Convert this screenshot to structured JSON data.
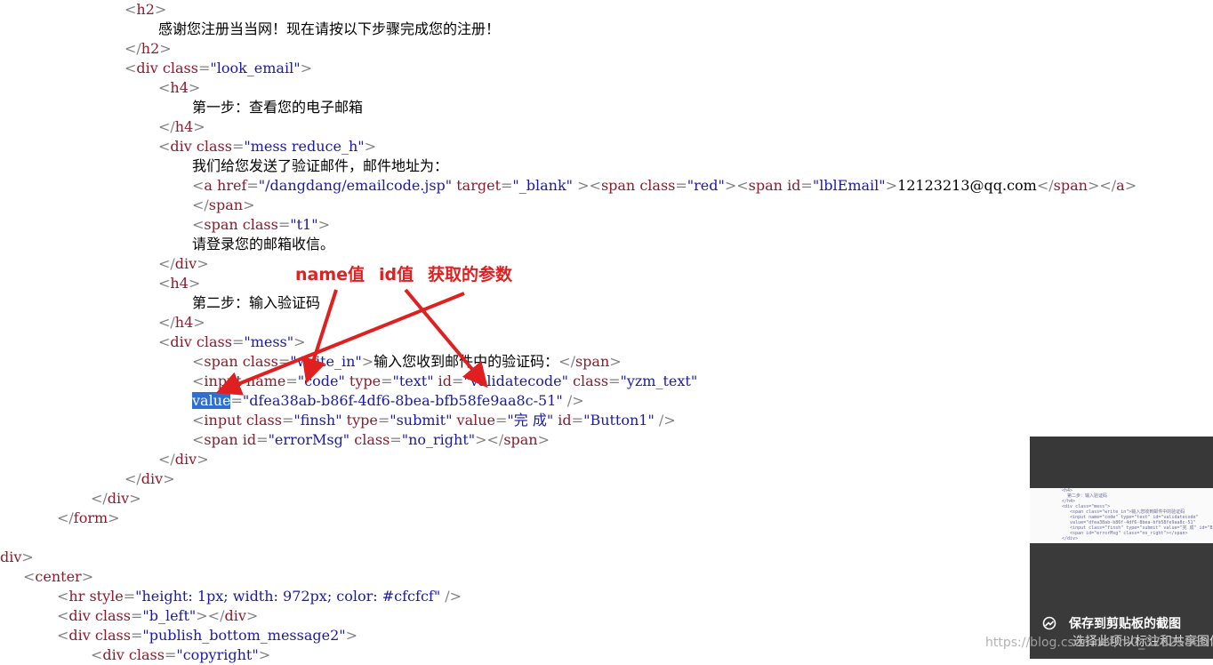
{
  "code_lines": [
    {
      "seg": [
        [
          "t",
          "<"
        ],
        [
          "tag",
          "h2"
        ],
        [
          "t",
          ">"
        ]
      ]
    },
    {
      "seg": [
        [
          "txt",
          "感谢您注册当当网！现在请按以下步骤完成您的注册！"
        ]
      ]
    },
    {
      "seg": [
        [
          "t",
          "</"
        ],
        [
          "tag",
          "h2"
        ],
        [
          "t",
          ">"
        ]
      ]
    },
    {
      "seg": [
        [
          "t",
          "<"
        ],
        [
          "tag",
          "div "
        ],
        [
          "attr",
          "class"
        ],
        [
          "t",
          "="
        ],
        [
          "val",
          "\"look_email\""
        ],
        [
          "t",
          ">"
        ]
      ]
    },
    {
      "seg": [
        [
          "t",
          "<"
        ],
        [
          "tag",
          "h4"
        ],
        [
          "t",
          ">"
        ]
      ]
    },
    {
      "seg": [
        [
          "txt",
          "第一步：查看您的电子邮箱"
        ]
      ]
    },
    {
      "seg": [
        [
          "t",
          "</"
        ],
        [
          "tag",
          "h4"
        ],
        [
          "t",
          ">"
        ]
      ]
    },
    {
      "seg": [
        [
          "t",
          "<"
        ],
        [
          "tag",
          "div "
        ],
        [
          "attr",
          "class"
        ],
        [
          "t",
          "="
        ],
        [
          "val",
          "\"mess reduce_h\""
        ],
        [
          "t",
          ">"
        ]
      ]
    },
    {
      "seg": [
        [
          "txt",
          "我们给您发送了验证邮件，邮件地址为："
        ]
      ]
    },
    {
      "seg": [
        [
          "t",
          "<"
        ],
        [
          "tag",
          "a "
        ],
        [
          "attr",
          "href"
        ],
        [
          "t",
          "="
        ],
        [
          "val",
          "\"/dangdang/emailcode.jsp\""
        ],
        [
          "attr",
          " target"
        ],
        [
          "t",
          "="
        ],
        [
          "val",
          "\"_blank\""
        ],
        [
          "t",
          " ><"
        ],
        [
          "tag",
          "span "
        ],
        [
          "attr",
          "class"
        ],
        [
          "t",
          "="
        ],
        [
          "val",
          "\"red\""
        ],
        [
          "t",
          "><"
        ],
        [
          "tag",
          "span "
        ],
        [
          "attr",
          "id"
        ],
        [
          "t",
          "="
        ],
        [
          "val",
          "\"lblEmail\""
        ],
        [
          "t",
          ">"
        ],
        [
          "txt",
          "12123213@qq.com"
        ],
        [
          "t",
          "</"
        ],
        [
          "tag",
          "span"
        ],
        [
          "t",
          "></"
        ],
        [
          "tag",
          "a"
        ],
        [
          "t",
          ">"
        ]
      ]
    },
    {
      "seg": [
        [
          "t",
          "</"
        ],
        [
          "tag",
          "span"
        ],
        [
          "t",
          ">"
        ]
      ]
    },
    {
      "seg": [
        [
          "t",
          "<"
        ],
        [
          "tag",
          "span "
        ],
        [
          "attr",
          "class"
        ],
        [
          "t",
          "="
        ],
        [
          "val",
          "\"t1\""
        ],
        [
          "t",
          ">"
        ]
      ]
    },
    {
      "seg": [
        [
          "txt",
          "请登录您的邮箱收信。"
        ]
      ]
    },
    {
      "seg": [
        [
          "t",
          "</"
        ],
        [
          "tag",
          "div"
        ],
        [
          "t",
          ">"
        ]
      ]
    },
    {
      "seg": [
        [
          "t",
          "<"
        ],
        [
          "tag",
          "h4"
        ],
        [
          "t",
          ">"
        ]
      ]
    },
    {
      "seg": [
        [
          "txt",
          "第二步：输入验证码"
        ]
      ]
    },
    {
      "seg": [
        [
          "t",
          "</"
        ],
        [
          "tag",
          "h4"
        ],
        [
          "t",
          ">"
        ]
      ]
    },
    {
      "seg": [
        [
          "t",
          "<"
        ],
        [
          "tag",
          "div "
        ],
        [
          "attr",
          "class"
        ],
        [
          "t",
          "="
        ],
        [
          "val",
          "\"mess\""
        ],
        [
          "t",
          ">"
        ]
      ]
    },
    {
      "seg": [
        [
          "t",
          "<"
        ],
        [
          "tag",
          "span "
        ],
        [
          "attr",
          "class"
        ],
        [
          "t",
          "="
        ],
        [
          "val",
          "\"write_in\""
        ],
        [
          "t",
          ">"
        ],
        [
          "txt",
          "输入您收到邮件中的验证码："
        ],
        [
          "t",
          "</"
        ],
        [
          "tag",
          "span"
        ],
        [
          "t",
          ">"
        ]
      ]
    },
    {
      "seg": [
        [
          "t",
          "<"
        ],
        [
          "tag",
          "input "
        ],
        [
          "attr",
          "name"
        ],
        [
          "t",
          "="
        ],
        [
          "val",
          "\"code\""
        ],
        [
          "attr",
          " type"
        ],
        [
          "t",
          "="
        ],
        [
          "val",
          "\"text\""
        ],
        [
          "attr",
          " id"
        ],
        [
          "t",
          "="
        ],
        [
          "val",
          "\"validatecode\""
        ],
        [
          "attr",
          " class"
        ],
        [
          "t",
          "="
        ],
        [
          "val",
          "\"yzm_text\""
        ]
      ]
    },
    {
      "seg": [
        [
          "sel",
          "value"
        ],
        [
          "t",
          "="
        ],
        [
          "val",
          "\"dfea38ab-b86f-4df6-8bea-bfb58fe9aa8c-51\""
        ],
        [
          "t",
          " />"
        ]
      ]
    },
    {
      "seg": [
        [
          "t",
          "<"
        ],
        [
          "tag",
          "input "
        ],
        [
          "attr",
          "class"
        ],
        [
          "t",
          "="
        ],
        [
          "val",
          "\"finsh\""
        ],
        [
          "attr",
          " type"
        ],
        [
          "t",
          "="
        ],
        [
          "val",
          "\"submit\""
        ],
        [
          "attr",
          " value"
        ],
        [
          "t",
          "="
        ],
        [
          "val",
          "\"完 成\""
        ],
        [
          "attr",
          " id"
        ],
        [
          "t",
          "="
        ],
        [
          "val",
          "\"Button1\""
        ],
        [
          "t",
          " />"
        ]
      ]
    },
    {
      "seg": [
        [
          "t",
          "<"
        ],
        [
          "tag",
          "span "
        ],
        [
          "attr",
          "id"
        ],
        [
          "t",
          "="
        ],
        [
          "val",
          "\"errorMsg\""
        ],
        [
          "attr",
          " class"
        ],
        [
          "t",
          "="
        ],
        [
          "val",
          "\"no_right\""
        ],
        [
          "t",
          "></"
        ],
        [
          "tag",
          "span"
        ],
        [
          "t",
          ">"
        ]
      ]
    },
    {
      "seg": [
        [
          "t",
          "</"
        ],
        [
          "tag",
          "div"
        ],
        [
          "t",
          ">"
        ]
      ]
    },
    {
      "seg": [
        [
          "t",
          "</"
        ],
        [
          "tag",
          "div"
        ],
        [
          "t",
          ">"
        ]
      ]
    },
    {
      "seg": [
        [
          "t",
          "</"
        ],
        [
          "tag",
          "div"
        ],
        [
          "t",
          ">"
        ]
      ]
    },
    {
      "seg": [
        [
          "t",
          "</"
        ],
        [
          "tag",
          "form"
        ],
        [
          "t",
          ">"
        ]
      ]
    },
    {
      "seg": []
    },
    {
      "seg": [
        [
          "tag",
          "div"
        ],
        [
          "t",
          ">"
        ]
      ]
    },
    {
      "seg": [
        [
          "t",
          "<"
        ],
        [
          "tag",
          "center"
        ],
        [
          "t",
          ">"
        ]
      ]
    },
    {
      "seg": [
        [
          "t",
          "<"
        ],
        [
          "tag",
          "hr "
        ],
        [
          "attr",
          "style"
        ],
        [
          "t",
          "="
        ],
        [
          "val",
          "\"height: 1px; width: 972px; color: #cfcfcf\""
        ],
        [
          "t",
          " />"
        ]
      ]
    },
    {
      "seg": [
        [
          "t",
          "<"
        ],
        [
          "tag",
          "div "
        ],
        [
          "attr",
          "class"
        ],
        [
          "t",
          "="
        ],
        [
          "val",
          "\"b_left\""
        ],
        [
          "t",
          "></"
        ],
        [
          "tag",
          "div"
        ],
        [
          "t",
          ">"
        ]
      ]
    },
    {
      "seg": [
        [
          "t",
          "<"
        ],
        [
          "tag",
          "div "
        ],
        [
          "attr",
          "class"
        ],
        [
          "t",
          "="
        ],
        [
          "val",
          "\"publish_bottom_message2\""
        ],
        [
          "t",
          ">"
        ]
      ]
    },
    {
      "seg": [
        [
          "t",
          "<"
        ],
        [
          "tag",
          "div "
        ],
        [
          "attr",
          "class"
        ],
        [
          "t",
          "="
        ],
        [
          "val",
          "\"copyright\""
        ],
        [
          "t",
          ">"
        ]
      ]
    }
  ],
  "annotations": {
    "name_label": "name值",
    "id_label": "id值",
    "param_label": "获取的参数"
  },
  "toast": {
    "title": "保存到剪贴板的截图",
    "subtitle": "选择此项以标注和共享图像"
  },
  "watermark": "https://blog.csdn.net/m0_37625860",
  "colors": {
    "annotation": "#e02020",
    "selection": "#2f6fd1",
    "tag": "#8b1c2c",
    "value": "#1a1aa6"
  }
}
